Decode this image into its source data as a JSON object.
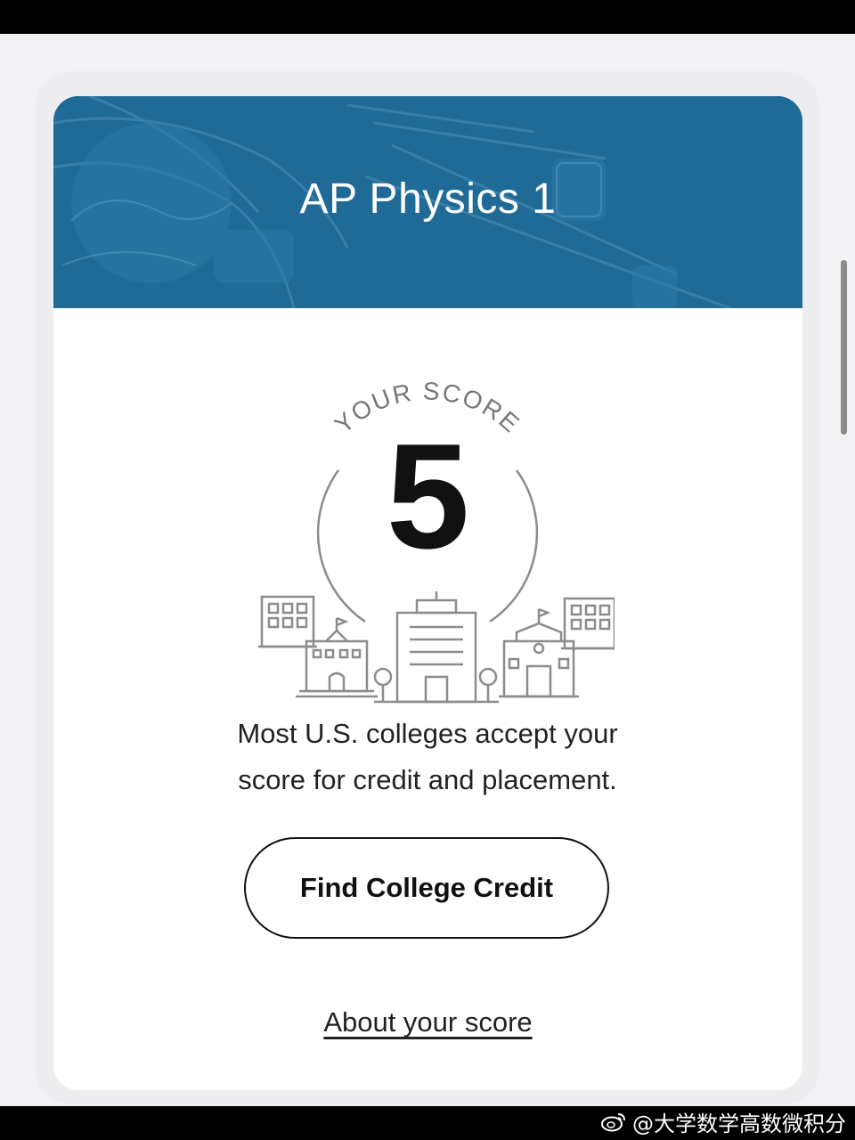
{
  "card": {
    "title": "AP Physics 1",
    "score_caption": "YOUR SCORE",
    "score": "5",
    "message_line1": "Most U.S. colleges accept your",
    "message_line2": "score for credit and placement.",
    "cta_label": "Find College Credit",
    "link_label": "About your score"
  },
  "watermark": {
    "text": "@大学数学高数微积分",
    "icon": "weibo-logo-icon"
  },
  "colors": {
    "header_blue": "#1f6a96",
    "text_dark": "#111111",
    "line_gray": "#8c8c8c"
  }
}
